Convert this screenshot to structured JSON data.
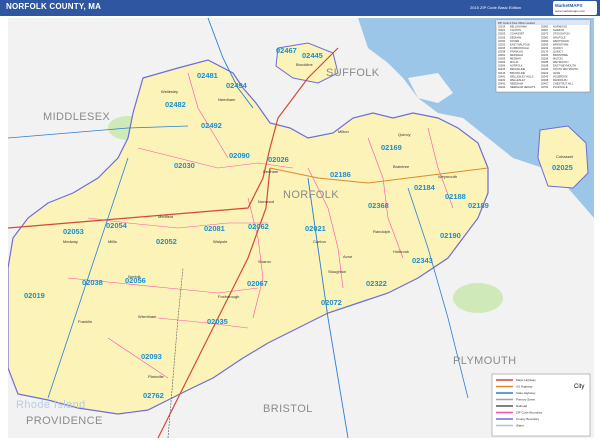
{
  "header": {
    "title": "NORFOLK COUNTY, MA",
    "edition": "2015 ZIP Code Basic Edition",
    "logo_text": "MarketMAPS",
    "logo_sub": "www.marketmaps.com"
  },
  "regions": {
    "middlesex": "MIDDLESEX",
    "suffolk": "SUFFOLK",
    "norfolk": "NORFOLK",
    "plymouth": "PLYMOUTH",
    "bristol": "BRISTOL",
    "providence": "PROVIDENCE",
    "rhode_island": "Rhode Island"
  },
  "zips": [
    "02467",
    "02445",
    "02481",
    "02494",
    "02482",
    "02492",
    "02090",
    "02026",
    "02030",
    "02169",
    "02186",
    "02184",
    "02188",
    "02189",
    "02053",
    "02054",
    "02052",
    "02081",
    "02062",
    "02021",
    "02368",
    "02190",
    "02343",
    "02056",
    "02038",
    "02019",
    "02067",
    "02072",
    "02322",
    "02035",
    "02093",
    "02762",
    "02025"
  ],
  "towns": [
    "Brookline",
    "Needham",
    "Wellesley",
    "Dedham",
    "Milton",
    "Quincy",
    "Braintree",
    "Weymouth",
    "Canton",
    "Sharon",
    "Walpole",
    "Norwood",
    "Foxborough",
    "Franklin",
    "Medfield",
    "Millis",
    "Stoughton",
    "Randolph",
    "Cohasset",
    "Medway",
    "Wrentham",
    "Plainville",
    "Holbrook",
    "Avon",
    "Norfolk"
  ],
  "index": {
    "title": "ZIP Code & Post Office Location",
    "rows": [
      [
        "02019",
        "BELLINGHAM",
        "02062",
        "NORWOOD"
      ],
      [
        "02021",
        "CANTON",
        "02067",
        "SHARON"
      ],
      [
        "02025",
        "COHASSET",
        "02072",
        "STOUGHTON"
      ],
      [
        "02026",
        "DEDHAM",
        "02081",
        "WALPOLE"
      ],
      [
        "02030",
        "DOVER",
        "02090",
        "WESTWOOD"
      ],
      [
        "02032",
        "EAST WALPOLE",
        "02093",
        "WRENTHAM"
      ],
      [
        "02035",
        "FOXBOROUGH",
        "02169",
        "QUINCY"
      ],
      [
        "02038",
        "FRANKLIN",
        "02170",
        "QUINCY"
      ],
      [
        "02052",
        "MEDFIELD",
        "02184",
        "BRAINTREE"
      ],
      [
        "02053",
        "MEDWAY",
        "02186",
        "MILTON"
      ],
      [
        "02054",
        "MILLIS",
        "02188",
        "WEYMOUTH"
      ],
      [
        "02056",
        "NORFOLK",
        "02189",
        "EAST WEYMOUTH"
      ],
      [
        "02445",
        "BROOKLINE",
        "02190",
        "SOUTH WEYMOUTH"
      ],
      [
        "02446",
        "BROOKLINE",
        "02322",
        "AVON"
      ],
      [
        "02481",
        "WELLESLEY HILLS",
        "02343",
        "HOLBROOK"
      ],
      [
        "02482",
        "WELLESLEY",
        "02368",
        "RANDOLPH"
      ],
      [
        "02492",
        "NEEDHAM",
        "02467",
        "CHESTNUT HILL"
      ],
      [
        "02494",
        "NEEDHAM HEIGHTS",
        "02762",
        "PLAINVILLE"
      ]
    ]
  },
  "legend": {
    "city_label": "City",
    "items": [
      {
        "label": "Major Highway",
        "color": "#d24a3a"
      },
      {
        "label": "US Highway",
        "color": "#e08a2a"
      },
      {
        "label": "State Highway",
        "color": "#2a7fd0"
      },
      {
        "label": "Primary Street",
        "color": "#a0a0a0"
      },
      {
        "label": "Railroad",
        "color": "#555555"
      },
      {
        "label": "ZIP Code Boundary",
        "color": "#ff4fb0"
      },
      {
        "label": "County Boundary",
        "color": "#6d6dd8"
      },
      {
        "label": "Water",
        "color": "#9cc6e8"
      }
    ]
  },
  "colors": {
    "title_bar": "#2f56a0",
    "county_fill": "#fbf3b8",
    "outside_fill": "#f2f2f2",
    "water": "#9cc6e8",
    "zip_label": "#1a8fd0",
    "county_border": "#6d6dd8",
    "park": "#cfe9b8"
  }
}
